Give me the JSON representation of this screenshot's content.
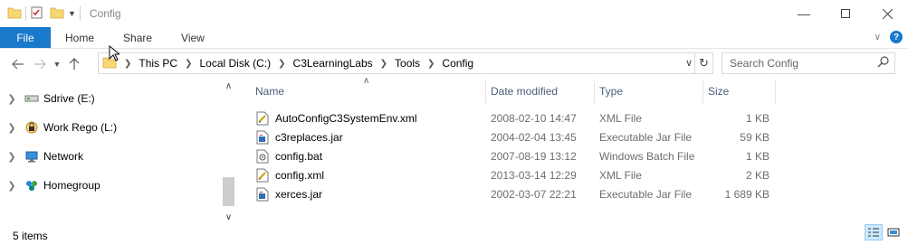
{
  "window": {
    "title": "Config"
  },
  "ribbon": {
    "tabs": [
      "File",
      "Home",
      "Share",
      "View"
    ]
  },
  "address": {
    "crumbs": [
      "This PC",
      "Local Disk (C:)",
      "C3LearningLabs",
      "Tools",
      "Config"
    ]
  },
  "search": {
    "placeholder": "Search Config"
  },
  "nav": {
    "items": [
      {
        "label": "Sdrive (E:)",
        "icon": "drive-icon"
      },
      {
        "label": "Work Rego (L:)",
        "icon": "locked-drive-icon"
      },
      {
        "label": "Network",
        "icon": "network-icon"
      },
      {
        "label": "Homegroup",
        "icon": "homegroup-icon"
      }
    ]
  },
  "columns": {
    "name": "Name",
    "date": "Date modified",
    "type": "Type",
    "size": "Size"
  },
  "files": [
    {
      "name": "AutoConfigC3SystemEnv.xml",
      "date": "2008-02-10 14:47",
      "type": "XML File",
      "size": "1 KB",
      "icon": "xml-file-icon"
    },
    {
      "name": "c3replaces.jar",
      "date": "2004-02-04 13:45",
      "type": "Executable Jar File",
      "size": "59 KB",
      "icon": "jar-file-icon"
    },
    {
      "name": "config.bat",
      "date": "2007-08-19 13:12",
      "type": "Windows Batch File",
      "size": "1 KB",
      "icon": "bat-file-icon"
    },
    {
      "name": "config.xml",
      "date": "2013-03-14 12:29",
      "type": "XML File",
      "size": "2 KB",
      "icon": "xml-file-icon"
    },
    {
      "name": "xerces.jar",
      "date": "2002-03-07 22:21",
      "type": "Executable Jar File",
      "size": "1 689 KB",
      "icon": "jar-file-icon"
    }
  ],
  "status": {
    "items": "5 items"
  },
  "colors": {
    "accent": "#1979ca",
    "header_text": "#4c607a",
    "folder": "#f8d775"
  }
}
